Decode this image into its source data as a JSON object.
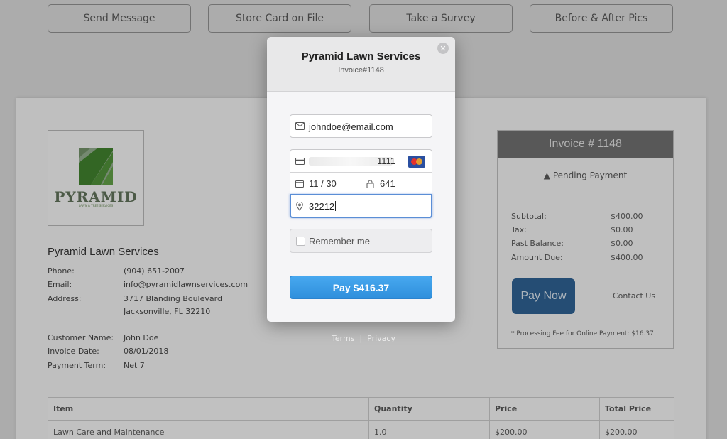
{
  "top_buttons": [
    "Send Message",
    "Store Card on File",
    "Take a Survey",
    "Before & After Pics"
  ],
  "logo": {
    "name": "PYRAMID",
    "tagline": "LAWN & TREE SERVICES"
  },
  "company": {
    "name": "Pyramid Lawn Services",
    "phone_label": "Phone:",
    "phone": "(904) 651-2007",
    "email_label": "Email:",
    "email": "info@pyramidlawnservices.com",
    "address_label": "Address:",
    "address_line1": "3717 Blanding Boulevard",
    "address_line2": "Jacksonville, FL 32210"
  },
  "customer": {
    "name_label": "Customer Name:",
    "name": "John Doe",
    "date_label": "Invoice Date:",
    "date": "08/01/2018",
    "term_label": "Payment Term:",
    "term": "Net 7"
  },
  "invoice_panel": {
    "title": "Invoice # 1148",
    "status": "Pending Payment",
    "status_icon": "warning-icon",
    "rows": [
      {
        "label": "Subtotal:",
        "value": "$400.00"
      },
      {
        "label": "Tax:",
        "value": "$0.00"
      },
      {
        "label": "Past Balance:",
        "value": "$0.00"
      },
      {
        "label": "Amount Due:",
        "value": "$400.00"
      }
    ],
    "pay_now": "Pay Now",
    "contact": "Contact Us",
    "fee_note": "* Processing Fee for Online Payment: $16.37"
  },
  "table": {
    "headers": [
      "Item",
      "Quantity",
      "Price",
      "Total Price"
    ],
    "rows": [
      [
        "Lawn Care and Maintenance",
        "1.0",
        "$200.00",
        "$200.00"
      ]
    ]
  },
  "footer_links": {
    "terms": "Terms",
    "separator": "|",
    "privacy": "Privacy"
  },
  "modal": {
    "title": "Pyramid Lawn Services",
    "subtitle": "Invoice#1148",
    "email_value": "johndoe@email.com",
    "card_last4": "1111",
    "expiry": "11 / 30",
    "cvc": "641",
    "zip": "32212",
    "remember_label": "Remember me",
    "pay_label": "Pay $416.37"
  },
  "colors": {
    "pay_button": "#3a9be6",
    "focus_border": "#5b8ed6",
    "invoice_header": "#6c6c6c"
  }
}
